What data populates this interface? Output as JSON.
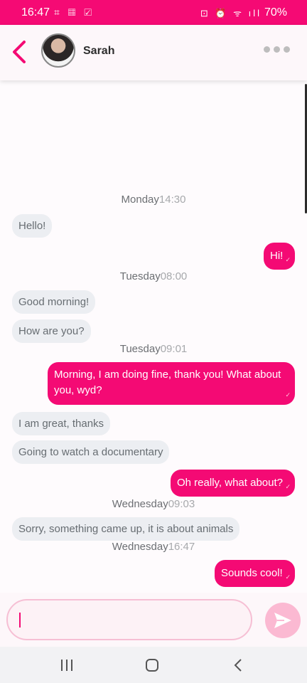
{
  "status": {
    "time": "16:47",
    "left_icons": "⌗ ▦ ☑",
    "right_icons": "⊡ ⏰ ᯤ ıll",
    "battery": "70%"
  },
  "header": {
    "contact_name": "Sarah",
    "back_icon": "chevron-left-icon",
    "more_icon": "more-horizontal-icon"
  },
  "messages": [
    {
      "type": "stamp",
      "day": "Monday",
      "time": "14:30"
    },
    {
      "type": "in",
      "text": "Hello!"
    },
    {
      "type": "out",
      "text": "Hi!"
    },
    {
      "type": "stamp",
      "day": "Tuesday",
      "time": "08:00"
    },
    {
      "type": "in",
      "text": "Good morning!"
    },
    {
      "type": "in",
      "text": "How are you?"
    },
    {
      "type": "stamp",
      "day": "Tuesday",
      "time": "09:01"
    },
    {
      "type": "out",
      "text": "Morning, I am doing fine, thank you! What about you, wyd?"
    },
    {
      "type": "in",
      "text": "I am great, thanks"
    },
    {
      "type": "in",
      "text": "Going to watch a documentary"
    },
    {
      "type": "out",
      "text": "Oh really, what about?"
    },
    {
      "type": "stamp",
      "day": "Wednesday",
      "time": "09:03"
    },
    {
      "type": "in",
      "text": "Sorry, something came up, it is about animals"
    },
    {
      "type": "stamp",
      "day": "Wednesday",
      "time": "16:47"
    },
    {
      "type": "out",
      "text": "Sounds cool!"
    }
  ],
  "composer": {
    "value": "",
    "send_icon": "send-icon"
  },
  "navbar": {
    "recent_icon": "recent-apps-icon",
    "home_icon": "home-icon",
    "back_icon": "back-icon"
  },
  "colors": {
    "accent": "#f40a74",
    "incoming_bubble": "#eceef2",
    "send_button": "#fbb9d2"
  }
}
